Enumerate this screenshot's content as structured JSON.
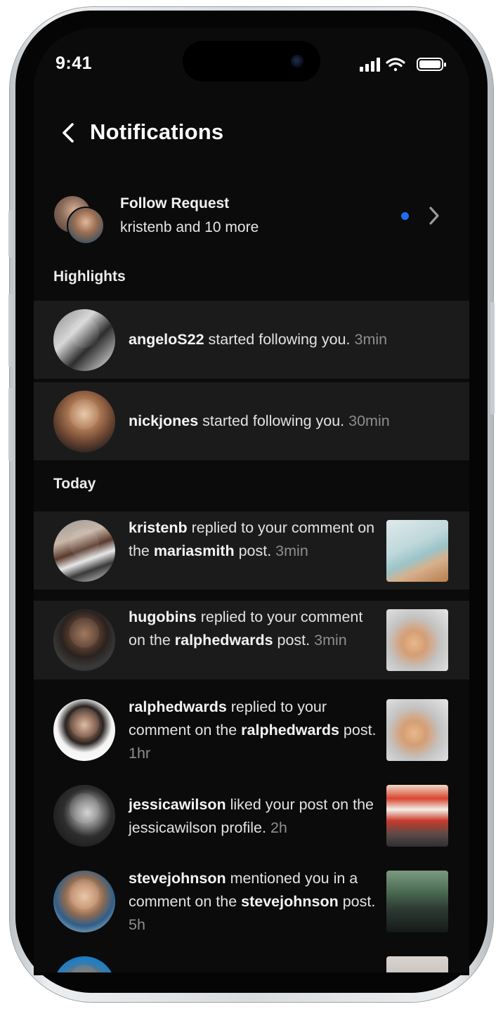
{
  "status_bar": {
    "time": "9:41"
  },
  "header": {
    "title": "Notifications"
  },
  "follow_request": {
    "title": "Follow Request",
    "subtitle": "kristenb and 10 more"
  },
  "sections": {
    "highlights": "Highlights",
    "today": "Today"
  },
  "highlights": [
    {
      "user": "angeloS22",
      "text": " started following you.",
      "time": "3min"
    },
    {
      "user": "nickjones",
      "text": " started following you.",
      "time": "30min"
    }
  ],
  "today": [
    {
      "user": "kristenb",
      "pre": " replied to your comment on the ",
      "target": "mariasmith",
      "post": " post.",
      "time": "3min"
    },
    {
      "user": "hugobins",
      "pre": " replied to your comment on the ",
      "target": "ralphedwards",
      "post": " post.",
      "time": "3min"
    },
    {
      "user": "ralphedwards",
      "pre": " replied to your comment on the ",
      "target": "ralphedwards",
      "post": " post.",
      "time": "1hr"
    },
    {
      "user": "jessicawilson",
      "pre": " liked your post on the jessicawilson profile.",
      "target": "",
      "post": "",
      "time": "2h"
    },
    {
      "user": "stevejohnson",
      "pre": " mentioned you in a comment on the ",
      "target": "stevejohnson",
      "post": " post.",
      "time": "5h"
    }
  ],
  "colors": {
    "unread_dot": "#1d6ff2",
    "background": "#0b0b0b",
    "row_highlight": "#1b1b1b"
  }
}
